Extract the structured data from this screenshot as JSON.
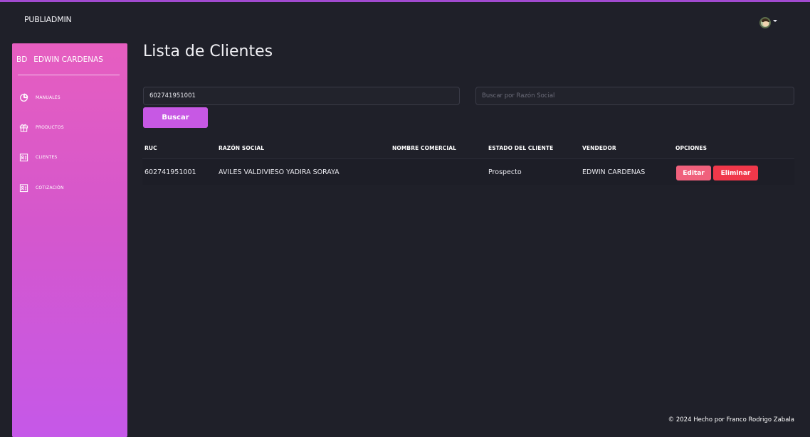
{
  "header": {
    "brand": "PUBLIADMIN"
  },
  "sidebar": {
    "user_initials": "BD",
    "user_name": "EDWIN CARDENAS",
    "items": [
      {
        "label": "MANUALES",
        "icon": "pie-chart-icon"
      },
      {
        "label": "PRODUCTOS",
        "icon": "gift-icon"
      },
      {
        "label": "CLIENTES",
        "icon": "contact-card-icon"
      },
      {
        "label": "COTIZACIÓN",
        "icon": "contact-card-icon"
      }
    ]
  },
  "main": {
    "title": "Lista de Clientes",
    "search": {
      "ruc_value": "602741951001",
      "razon_placeholder": "Buscar por Razón Social",
      "button_label": "Buscar"
    },
    "table": {
      "columns": [
        "RUC",
        "RAZÓN SOCIAL",
        "NOMBRE COMERCIAL",
        "ESTADO DEL CLIENTE",
        "VENDEDOR",
        "OPCIONES"
      ],
      "rows": [
        {
          "ruc": "602741951001",
          "razon_social": "AVILES VALDIVIESO YADIRA SORAYA",
          "nombre_comercial": "",
          "estado": "Prospecto",
          "vendedor": "EDWIN CARDENAS",
          "edit_label": "Editar",
          "delete_label": "Eliminar"
        }
      ]
    }
  },
  "footer": {
    "text": "© 2024 Hecho por Franco Rodrigo Zabala"
  },
  "colors": {
    "background": "#1f2029",
    "accent": "#c758e4",
    "sidebar_top": "#e65ec0",
    "sidebar_bottom": "#c558e8",
    "edit_button": "#f0617c",
    "delete_button": "#f0384a"
  }
}
